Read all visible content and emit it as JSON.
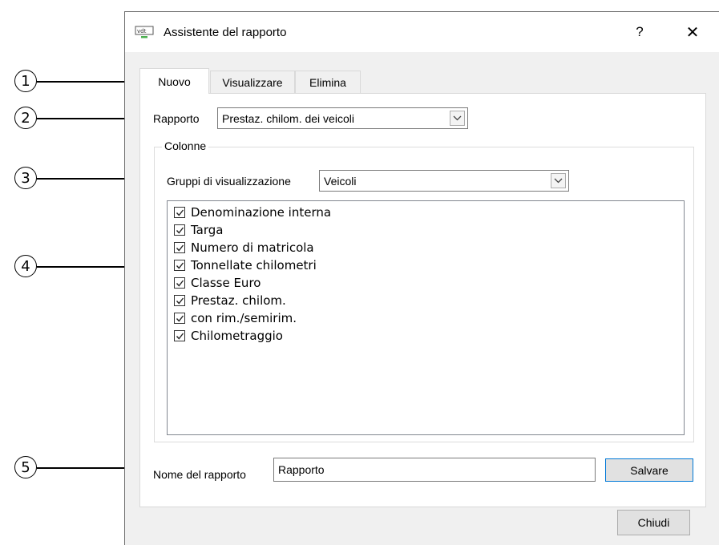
{
  "window": {
    "title": "Assistente del rapporto",
    "help_label": "?",
    "close_label": "✕",
    "app_icon": "report-app-icon"
  },
  "tabs": [
    {
      "label": "Nuovo",
      "active": true
    },
    {
      "label": "Visualizzare",
      "active": false
    },
    {
      "label": "Elimina",
      "active": false
    }
  ],
  "form": {
    "report_label": "Rapporto",
    "report_value": "Prestaz. chilom. dei veicoli",
    "columns_group_title": "Colonne",
    "display_groups_label": "Gruppi di visualizzazione",
    "display_groups_value": "Veicoli",
    "columns": [
      {
        "label": "Denominazione interna",
        "checked": true
      },
      {
        "label": "Targa",
        "checked": true
      },
      {
        "label": "Numero di matricola",
        "checked": true
      },
      {
        "label": "Tonnellate chilometri",
        "checked": true
      },
      {
        "label": "Classe Euro",
        "checked": true
      },
      {
        "label": "Prestaz. chilom.",
        "checked": true
      },
      {
        "label": "con rim./semirim.",
        "checked": true
      },
      {
        "label": "Chilometraggio",
        "checked": true
      }
    ],
    "report_name_label": "Nome del rapporto",
    "report_name_value": "Rapporto",
    "save_label": "Salvare"
  },
  "close_button_label": "Chiudi",
  "callouts": [
    "1",
    "2",
    "3",
    "4",
    "5"
  ]
}
